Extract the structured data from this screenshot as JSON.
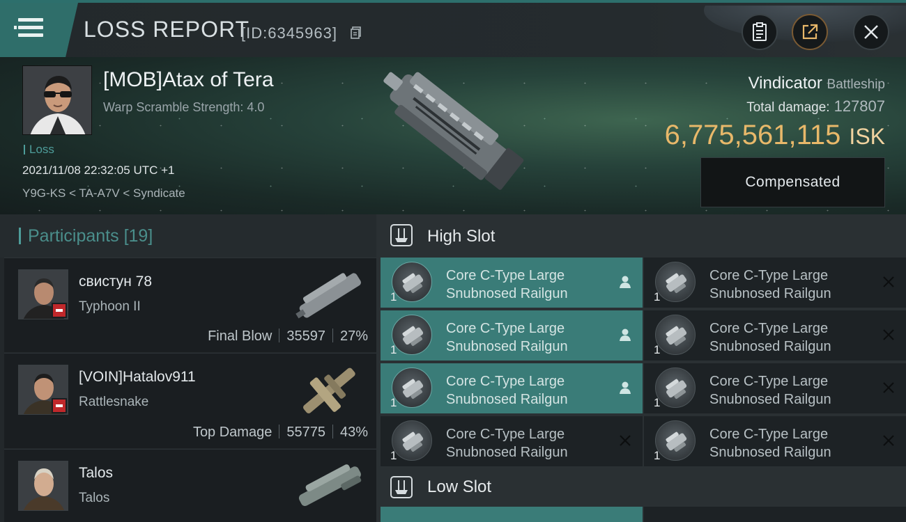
{
  "header": {
    "title": "LOSS REPORT",
    "report_id": "[ID:6345963]",
    "icons": [
      "menu-icon",
      "copy-icon",
      "clipboard-icon",
      "share-icon",
      "close-icon"
    ]
  },
  "victim": {
    "name": "[MOB]Atax of Tera",
    "warp_scramble": "Warp Scramble Strength: 4.0",
    "loss_label": "Loss",
    "timestamp": "2021/11/08 22:32:05 UTC +1",
    "location": "Y9G-KS < TA-A7V < Syndicate",
    "ship_name": "Vindicator",
    "ship_class": "Battleship",
    "total_damage_label": "Total damage:",
    "total_damage": "127807",
    "isk_value": "6,775,561,115",
    "isk_unit": "ISK",
    "compensated_label": "Compensated"
  },
  "participants": {
    "label": "Participants",
    "count": "[19]",
    "items": [
      {
        "name": "свистун 78",
        "ship": "Typhoon II",
        "role": "Final Blow",
        "damage": "35597",
        "percent": "27%"
      },
      {
        "name": "[VOIN]Hatalov911",
        "ship": "Rattlesnake",
        "role": "Top Damage",
        "damage": "55775",
        "percent": "43%"
      },
      {
        "name": "Talos",
        "ship": "Talos"
      }
    ]
  },
  "high_slot": {
    "label": "High Slot",
    "left": [
      {
        "name": "Core C-Type Large Snubnosed Railgun",
        "qty": "1",
        "highlighted": true
      },
      {
        "name": "Core C-Type Large Snubnosed Railgun",
        "qty": "1",
        "highlighted": true
      },
      {
        "name": "Core C-Type Large Snubnosed Railgun",
        "qty": "1",
        "highlighted": true
      },
      {
        "name": "Core C-Type Large Snubnosed Railgun",
        "qty": "1",
        "highlighted": false
      }
    ],
    "right": [
      {
        "name": "Core C-Type Large Snubnosed Railgun",
        "qty": "1",
        "highlighted": false
      },
      {
        "name": "Core C-Type Large Snubnosed Railgun",
        "qty": "1",
        "highlighted": false
      },
      {
        "name": "Core C-Type Large Snubnosed Railgun",
        "qty": "1",
        "highlighted": false
      },
      {
        "name": "Core C-Type Large Snubnosed Railgun",
        "qty": "1",
        "highlighted": false
      }
    ]
  },
  "low_slot": {
    "label": "Low Slot"
  },
  "colors": {
    "accent": "#3a7c78",
    "isk": "#e8b86a",
    "badge": "#c0282b"
  }
}
